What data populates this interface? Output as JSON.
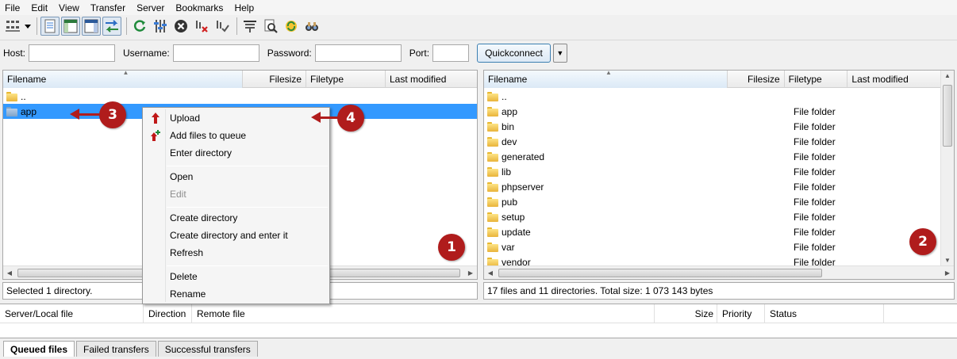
{
  "menu": [
    "File",
    "Edit",
    "View",
    "Transfer",
    "Server",
    "Bookmarks",
    "Help"
  ],
  "toolbar": {
    "icons": [
      "site-manager-icon",
      "dropdown-arrow-icon",
      "message-log-icon",
      "local-tree-icon",
      "remote-tree-icon",
      "transfer-queue-icon",
      "refresh-icon",
      "process-queue-icon",
      "cancel-icon",
      "disconnect-icon",
      "reconnect-icon",
      "filter-icon",
      "search-files-icon",
      "compare-icon",
      "find-icon"
    ]
  },
  "quickconnect": {
    "host_label": "Host:",
    "username_label": "Username:",
    "password_label": "Password:",
    "port_label": "Port:",
    "host_value": "",
    "username_value": "",
    "password_value": "",
    "port_value": "",
    "button": "Quickconnect"
  },
  "local": {
    "columns": [
      "Filename",
      "Filesize",
      "Filetype",
      "Last modified"
    ],
    "rows": [
      {
        "name": ".."
      },
      {
        "name": "app",
        "selected": true
      }
    ],
    "status": "Selected 1 directory."
  },
  "remote": {
    "columns": [
      "Filename",
      "Filesize",
      "Filetype",
      "Last modified"
    ],
    "rows": [
      {
        "name": "..",
        "type": ""
      },
      {
        "name": "app",
        "type": "File folder"
      },
      {
        "name": "bin",
        "type": "File folder"
      },
      {
        "name": "dev",
        "type": "File folder"
      },
      {
        "name": "generated",
        "type": "File folder"
      },
      {
        "name": "lib",
        "type": "File folder"
      },
      {
        "name": "phpserver",
        "type": "File folder"
      },
      {
        "name": "pub",
        "type": "File folder"
      },
      {
        "name": "setup",
        "type": "File folder"
      },
      {
        "name": "update",
        "type": "File folder"
      },
      {
        "name": "var",
        "type": "File folder"
      },
      {
        "name": "vendor",
        "type": "File folder"
      }
    ],
    "status": "17 files and 11 directories. Total size: 1 073 143 bytes"
  },
  "context_menu": {
    "items": [
      "Upload",
      "Add files to queue",
      "Enter directory",
      "Open",
      "Edit",
      "Create directory",
      "Create directory and enter it",
      "Refresh",
      "Delete",
      "Rename"
    ]
  },
  "queue": {
    "columns": [
      "Server/Local file",
      "Direction",
      "Remote file",
      "Size",
      "Priority",
      "Status"
    ],
    "tabs": [
      "Queued files",
      "Failed transfers",
      "Successful transfers"
    ]
  },
  "callouts": [
    "1",
    "2",
    "3",
    "4"
  ],
  "colors": {
    "accent": "#b01c1c",
    "selection": "#3399ff"
  }
}
